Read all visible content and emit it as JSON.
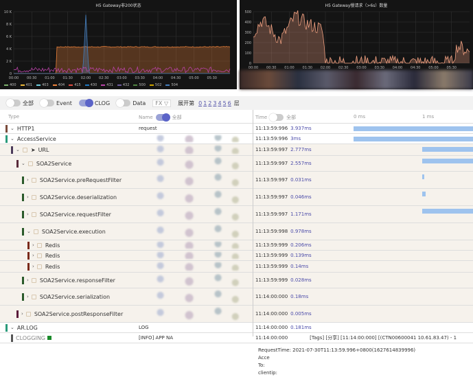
{
  "charts": [
    {
      "title": "H5 Gateway非200状态",
      "y_ticks": [
        "10 K",
        "8 K",
        "6 K",
        "4 K",
        "2 K",
        "0"
      ],
      "x_ticks": [
        "00:00",
        "00:30",
        "01:00",
        "01:30",
        "02:00",
        "02:30",
        "03:00",
        "03:30",
        "04:00",
        "04:30",
        "05:00",
        "05:30"
      ],
      "legend": [
        {
          "label": "400",
          "color": "#7eb26d"
        },
        {
          "label": "401",
          "color": "#eab839"
        },
        {
          "label": "403",
          "color": "#6ed0e0"
        },
        {
          "label": "404",
          "color": "#ef843c"
        },
        {
          "label": "415",
          "color": "#e24d42"
        },
        {
          "label": "430",
          "color": "#1f78c1"
        },
        {
          "label": "431",
          "color": "#ba43a9"
        },
        {
          "label": "432",
          "color": "#705da0"
        },
        {
          "label": "500",
          "color": "#508642"
        },
        {
          "label": "502",
          "color": "#cca300"
        },
        {
          "label": "504",
          "color": "#447ebc"
        }
      ]
    },
    {
      "title": "H5 Gateway慢请求（>6s）数量",
      "y_ticks": [
        "500",
        "400",
        "300",
        "200",
        "100",
        "0"
      ],
      "x_ticks": [
        "00:00",
        "00:30",
        "01:00",
        "01:30",
        "02:00",
        "02:30",
        "03:00",
        "03:30",
        "04:00",
        "04:30",
        "05:00",
        "05:30"
      ]
    }
  ],
  "chart_data": [
    {
      "type": "area",
      "title": "H5 Gateway非200状态",
      "ylim": [
        0,
        10000
      ],
      "series": [
        {
          "name": "404",
          "x": [
            "00:00",
            "01:10",
            "01:11",
            "06:00"
          ],
          "values": [
            0,
            0,
            4300,
            4300
          ]
        },
        {
          "name": "430",
          "x": [
            "01:55",
            "02:00",
            "02:05"
          ],
          "values": [
            0,
            9500,
            0
          ]
        },
        {
          "name": "431",
          "x": [
            "00:00",
            "06:00"
          ],
          "values": [
            600,
            600
          ]
        }
      ]
    },
    {
      "type": "area",
      "title": "H5 Gateway慢请求（>6s）数量",
      "ylim": [
        0,
        500
      ],
      "series": [
        {
          "x": [
            "00:00",
            "00:15",
            "00:45",
            "01:10",
            "01:30",
            "01:55",
            "02:00",
            "05:30",
            "05:40",
            "06:00"
          ],
          "values": [
            300,
            420,
            220,
            460,
            380,
            330,
            10,
            5,
            170,
            110
          ]
        }
      ]
    }
  ],
  "toolbar": {
    "all": "全部",
    "event": "Event",
    "clog": "CLOG",
    "data": "Data",
    "fx": "FX",
    "expand": "展开第",
    "levels": [
      "0",
      "1",
      "2",
      "3",
      "4",
      "5",
      "6"
    ],
    "level_suffix": "层"
  },
  "header": {
    "type": "Type",
    "name": "Name",
    "name_all": "全部",
    "time": "Time",
    "time_all": "全部",
    "ms0": "0 ms",
    "ms1": "1 ms"
  },
  "rows": [
    {
      "type": "HTTP1",
      "name": "request",
      "start": "11:13:59:996",
      "dur": "3.937ms",
      "color": "#7a4a3a",
      "indent": 0,
      "open": true
    },
    {
      "type": "AccessService",
      "start": "11:13:59:996",
      "dur": "3ms",
      "color": "#2a9a7a",
      "indent": 0,
      "open": true
    },
    {
      "type": "URL",
      "start": "11:13:59:997",
      "dur": "2.777ms",
      "color": "#4a3a5a",
      "indent": 1,
      "open": true,
      "send": true
    },
    {
      "type": "SOA2Service",
      "start": "11:13:59:997",
      "dur": "2.557ms",
      "color": "#5a2a3a",
      "indent": 2,
      "open": true
    },
    {
      "type": "SOA2Service.preRequestFilter",
      "start": "11:13:59:997",
      "dur": "0.031ms",
      "color": "#2a5a2a",
      "indent": 3
    },
    {
      "type": "SOA2Service.deserialization",
      "start": "11:13:59:997",
      "dur": "0.046ms",
      "color": "#2a5a2a",
      "indent": 3
    },
    {
      "type": "SOA2Service.requestFilter",
      "start": "11:13:59:997",
      "dur": "1.171ms",
      "color": "#2a5a2a",
      "indent": 3
    },
    {
      "type": "SOA2Service.execution",
      "start": "11:13:59:998",
      "dur": "0.978ms",
      "color": "#2a5a2a",
      "indent": 3,
      "open": true
    },
    {
      "type": "Redis",
      "start": "11:13:59:999",
      "dur": "0.206ms",
      "color": "#7a2a1a",
      "indent": 4
    },
    {
      "type": "Redis",
      "start": "11:13:59:999",
      "dur": "0.139ms",
      "color": "#7a2a1a",
      "indent": 4
    },
    {
      "type": "Redis",
      "start": "11:13:59:999",
      "dur": "0.14ms",
      "color": "#7a2a1a",
      "indent": 4
    },
    {
      "type": "SOA2Service.responseFilter",
      "start": "11:13:59:999",
      "dur": "0.028ms",
      "color": "#2a5a2a",
      "indent": 3
    },
    {
      "type": "SOA2Service.serialization",
      "start": "11:14:00:000",
      "dur": "0.18ms",
      "color": "#2a5a2a",
      "indent": 3
    },
    {
      "type": "SOA2Service.postResponseFilter",
      "start": "11:14:00:000",
      "dur": "0.005ms",
      "color": "#5a1a3a",
      "indent": 2
    },
    {
      "type": "AR.LOG",
      "name": "LOG",
      "start": "11:14:00:000",
      "dur": "0.181ms",
      "color": "#2a9a7a",
      "indent": 0,
      "open": true
    },
    {
      "type": "CLOGGING",
      "name": "[INFO] APP NA",
      "start": "11:14:00:000",
      "dur": "",
      "color": "#555",
      "indent": 1,
      "clog": true,
      "tags": "[Tags]  [分享]   [11:14:00:000]   [(CTN00600041 10.61.83.47) - 1"
    }
  ],
  "detail": [
    "RequestTime: 2021-07-30T11:13:59.996+0800(1627614839996)",
    "Acce",
    "To:",
    "clientip:"
  ]
}
